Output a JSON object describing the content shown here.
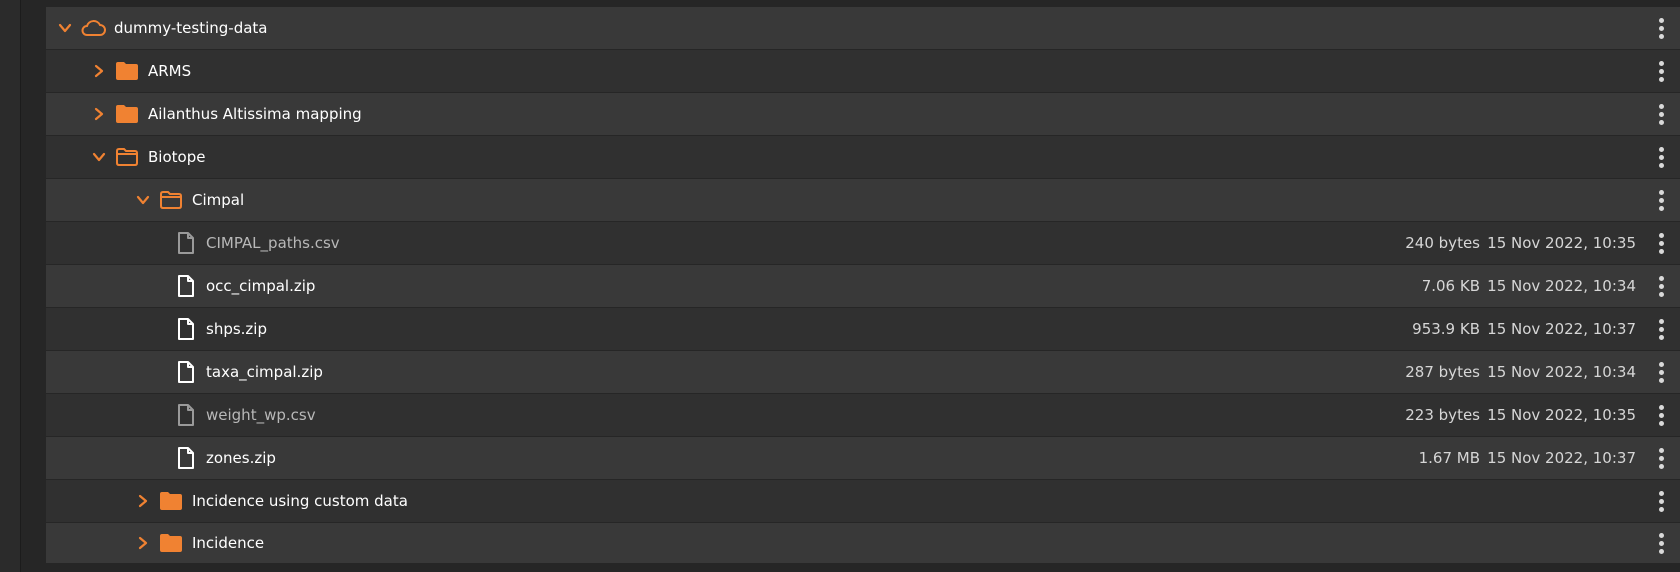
{
  "colors": {
    "accent": "#f08232",
    "row_odd": "#393939",
    "row_even": "#303030",
    "background": "#262626",
    "text": "#ffffff",
    "text_dim": "#b8b8b8"
  },
  "tree": {
    "root": {
      "name": "dummy-testing-data",
      "icon": "cloud-icon",
      "expanded": true
    },
    "folders_level1": [
      {
        "name": "ARMS",
        "expanded": false
      },
      {
        "name": "Ailanthus Altissima mapping",
        "expanded": false
      },
      {
        "name": "Biotope",
        "expanded": true
      }
    ],
    "subfolders": [
      {
        "name": "Cimpal",
        "expanded": true
      },
      {
        "name": "Incidence using custom data",
        "expanded": false
      },
      {
        "name": "Incidence",
        "expanded": false
      }
    ],
    "files": [
      {
        "name": "CIMPAL_paths.csv",
        "size": "240 bytes",
        "date": "15 Nov 2022, 10:35",
        "dimmed": true
      },
      {
        "name": "occ_cimpal.zip",
        "size": "7.06 KB",
        "date": "15 Nov 2022, 10:34",
        "dimmed": false
      },
      {
        "name": "shps.zip",
        "size": "953.9 KB",
        "date": "15 Nov 2022, 10:37",
        "dimmed": false
      },
      {
        "name": "taxa_cimpal.zip",
        "size": "287 bytes",
        "date": "15 Nov 2022, 10:34",
        "dimmed": false
      },
      {
        "name": "weight_wp.csv",
        "size": "223 bytes",
        "date": "15 Nov 2022, 10:35",
        "dimmed": true
      },
      {
        "name": "zones.zip",
        "size": "1.67 MB",
        "date": "15 Nov 2022, 10:37",
        "dimmed": false
      }
    ]
  }
}
